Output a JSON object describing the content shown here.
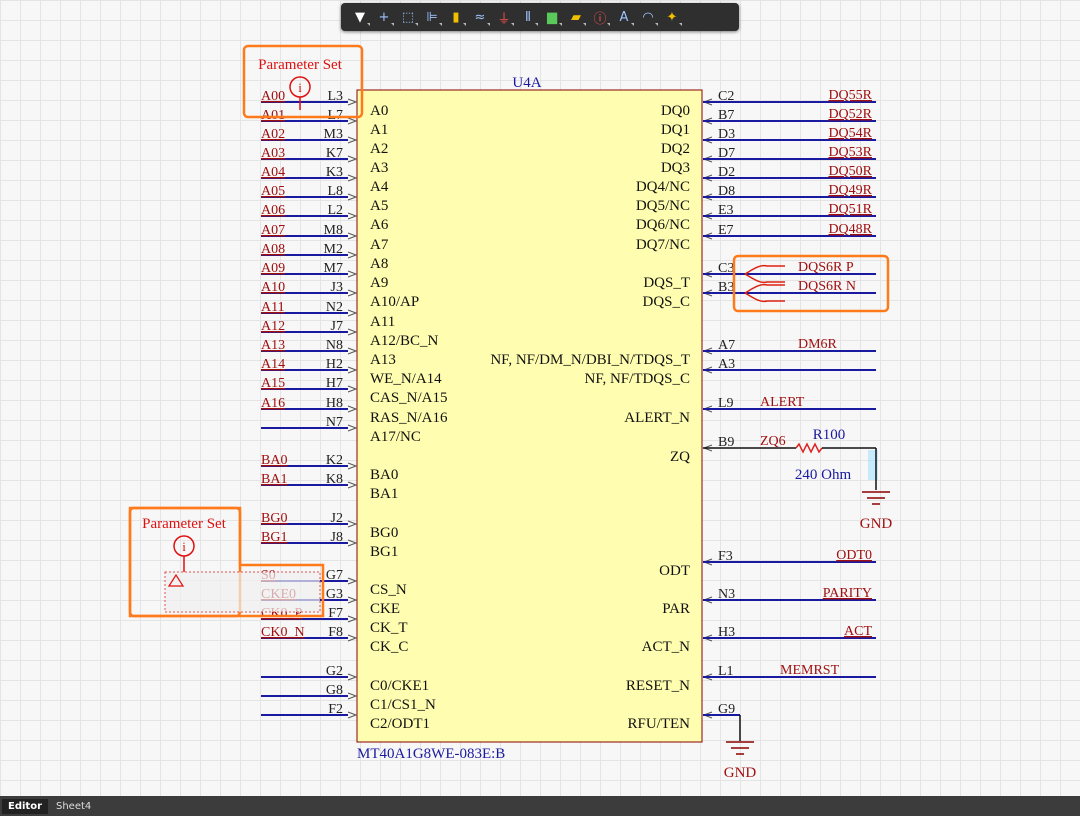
{
  "toolbar": {
    "tools": [
      {
        "icon": "filter-icon",
        "glyph": "▼",
        "color": "#ffffff"
      },
      {
        "icon": "crosshair-icon",
        "glyph": "+",
        "color": "#9fc4ff"
      },
      {
        "icon": "select-rect-icon",
        "glyph": "⬚",
        "color": "#9fc4ff"
      },
      {
        "icon": "align-icon",
        "glyph": "⊫",
        "color": "#9fc4ff"
      },
      {
        "icon": "component-icon",
        "glyph": "▮",
        "color": "#f0c000"
      },
      {
        "icon": "wire-icon",
        "glyph": "≈",
        "color": "#9fc4ff"
      },
      {
        "icon": "power-port-icon",
        "glyph": "⏚",
        "color": "#ff5050"
      },
      {
        "icon": "bus-icon",
        "glyph": "⦀",
        "color": "#9fc4ff"
      },
      {
        "icon": "harness-icon",
        "glyph": "▆",
        "color": "#5ac85a"
      },
      {
        "icon": "port-icon",
        "glyph": "▰",
        "color": "#f0c000"
      },
      {
        "icon": "parameter-set-icon",
        "glyph": "ⓘ",
        "color": "#ff5050"
      },
      {
        "icon": "text-icon",
        "glyph": "A",
        "color": "#9fc4ff"
      },
      {
        "icon": "arc-icon",
        "glyph": "◠",
        "color": "#9fc4ff"
      },
      {
        "icon": "highlight-icon",
        "glyph": "✦",
        "color": "#f0c000"
      }
    ]
  },
  "component": {
    "designator": "U4A",
    "part_number": "MT40A1G8WE-083E:B",
    "left_pins": [
      {
        "pin": "L3",
        "name": "A0",
        "net": "A00"
      },
      {
        "pin": "L7",
        "name": "A1",
        "net": "A01"
      },
      {
        "pin": "M3",
        "name": "A2",
        "net": "A02"
      },
      {
        "pin": "K7",
        "name": "A3",
        "net": "A03"
      },
      {
        "pin": "K3",
        "name": "A4",
        "net": "A04"
      },
      {
        "pin": "L8",
        "name": "A5",
        "net": "A05"
      },
      {
        "pin": "L2",
        "name": "A6",
        "net": "A06"
      },
      {
        "pin": "M8",
        "name": "A7",
        "net": "A07"
      },
      {
        "pin": "M2",
        "name": "A8",
        "net": "A08"
      },
      {
        "pin": "M7",
        "name": "A9",
        "net": "A09"
      },
      {
        "pin": "J3",
        "name": "A10/AP",
        "net": "A10"
      },
      {
        "pin": "N2",
        "name": "A11",
        "net": "A11"
      },
      {
        "pin": "J7",
        "name": "A12/BC_N",
        "net": "A12"
      },
      {
        "pin": "N8",
        "name": "A13",
        "net": "A13"
      },
      {
        "pin": "H2",
        "name": "WE_N/A14",
        "net": "A14"
      },
      {
        "pin": "H7",
        "name": "CAS_N/A15",
        "net": "A15"
      },
      {
        "pin": "H8",
        "name": "RAS_N/A16",
        "net": "A16"
      },
      {
        "pin": "N7",
        "name": "A17/NC",
        "net": ""
      },
      {
        "pin": "K2",
        "name": "BA0",
        "net": "BA0"
      },
      {
        "pin": "K8",
        "name": "BA1",
        "net": "BA1"
      },
      {
        "pin": "J2",
        "name": "BG0",
        "net": "BG0"
      },
      {
        "pin": "J8",
        "name": "BG1",
        "net": "BG1"
      },
      {
        "pin": "G7",
        "name": "CS_N",
        "net": "S0"
      },
      {
        "pin": "G3",
        "name": "CKE",
        "net": "CKE0"
      },
      {
        "pin": "F7",
        "name": "CK_T",
        "net": "CK0_P"
      },
      {
        "pin": "F8",
        "name": "CK_C",
        "net": "CK0_N"
      },
      {
        "pin": "G2",
        "name": "C0/CKE1",
        "net": ""
      },
      {
        "pin": "G8",
        "name": "C1/CS1_N",
        "net": ""
      },
      {
        "pin": "F2",
        "name": "C2/ODT1",
        "net": ""
      }
    ],
    "right_pins": [
      {
        "pin": "C2",
        "name": "DQ0",
        "net": "DQ55R"
      },
      {
        "pin": "B7",
        "name": "DQ1",
        "net": "DQ52R"
      },
      {
        "pin": "D3",
        "name": "DQ2",
        "net": "DQ54R"
      },
      {
        "pin": "D7",
        "name": "DQ3",
        "net": "DQ53R"
      },
      {
        "pin": "D2",
        "name": "DQ4/NC",
        "net": "DQ50R"
      },
      {
        "pin": "D8",
        "name": "DQ5/NC",
        "net": "DQ49R"
      },
      {
        "pin": "E3",
        "name": "DQ6/NC",
        "net": "DQ51R"
      },
      {
        "pin": "E7",
        "name": "DQ7/NC",
        "net": "DQ48R"
      },
      {
        "pin": "C3",
        "name": "DQS_T",
        "net": "DQS6R_P"
      },
      {
        "pin": "B3",
        "name": "DQS_C",
        "net": "DQS6R_N"
      },
      {
        "pin": "A7",
        "name": "NF, NF/DM_N/DBI_N/TDQS_T",
        "net": "DM6R"
      },
      {
        "pin": "A3",
        "name": "NF, NF/TDQS_C",
        "net": ""
      },
      {
        "pin": "L9",
        "name": "ALERT_N",
        "net": "ALERT"
      },
      {
        "pin": "B9",
        "name": "ZQ",
        "net": "ZQ6"
      },
      {
        "pin": "F3",
        "name": "ODT",
        "net": "ODT0"
      },
      {
        "pin": "N3",
        "name": "PAR",
        "net": "PARITY"
      },
      {
        "pin": "H3",
        "name": "ACT_N",
        "net": "ACT"
      },
      {
        "pin": "L1",
        "name": "RESET_N",
        "net": "MEMRST"
      },
      {
        "pin": "G9",
        "name": "RFU/TEN",
        "net": ""
      }
    ]
  },
  "resistor": {
    "designator": "R100",
    "value": "240 Ohm"
  },
  "gnd_label": "GND",
  "param_set_label": "Parameter Set",
  "colors": {
    "wire": "#1a1aa0",
    "net": "#a01010",
    "body": "#fffeb0",
    "body_border": "#8b0000",
    "highlight": "#ff7a1a",
    "label": "#1a1aa0"
  },
  "statusbar": {
    "tabs": [
      "Editor",
      "Sheet4"
    ]
  }
}
